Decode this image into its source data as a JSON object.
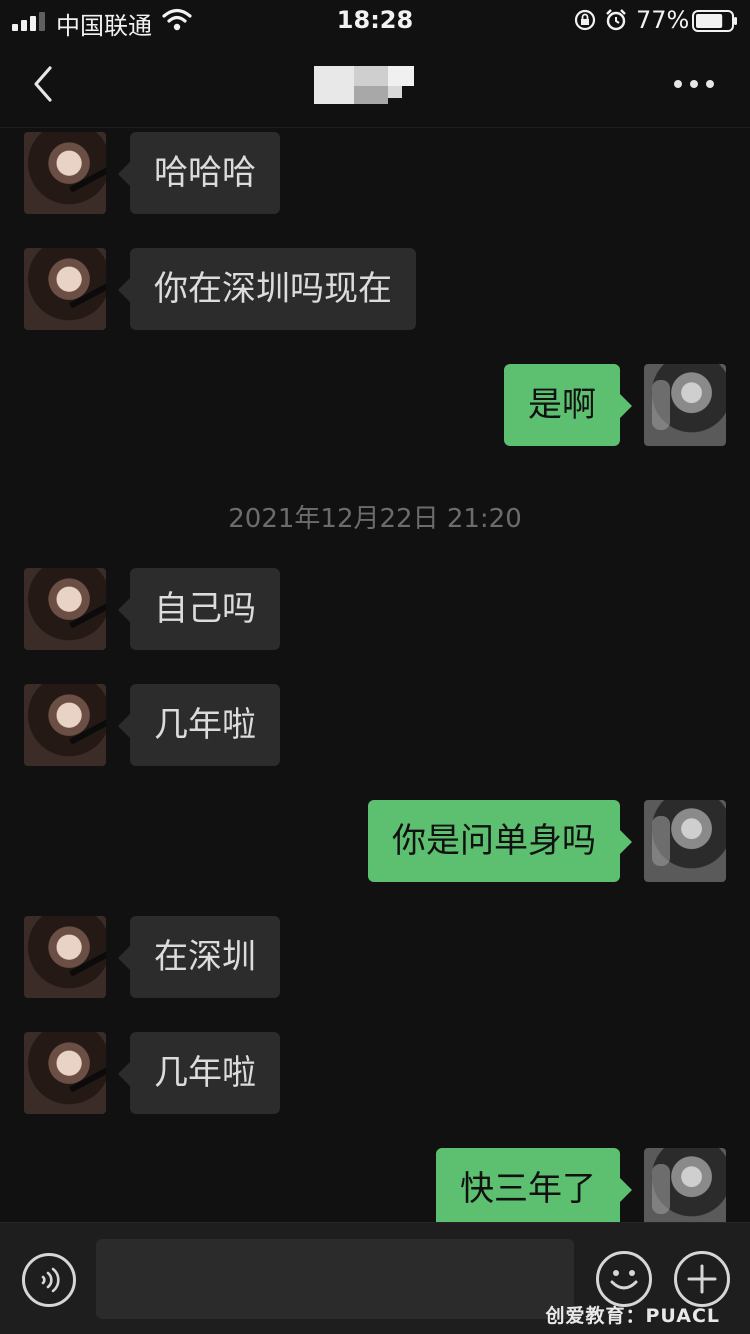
{
  "status_bar": {
    "carrier": "中国联通",
    "time": "18:28",
    "battery_percent": "77%",
    "battery_level": 0.77,
    "icons": [
      "signal-icon",
      "wifi-icon",
      "rotation-lock-icon",
      "alarm-icon",
      "battery-icon"
    ]
  },
  "nav": {
    "back_icon": "chevron-left-icon",
    "contact_name_obscured": true,
    "more_icon": "more-dots-icon"
  },
  "messages": [
    {
      "side": "in",
      "text": "哈哈哈"
    },
    {
      "side": "in",
      "text": "你在深圳吗现在"
    },
    {
      "side": "out",
      "text": "是啊"
    },
    {
      "type": "timestamp",
      "text": "2021年12月22日 21:20"
    },
    {
      "side": "in",
      "text": "自己吗"
    },
    {
      "side": "in",
      "text": "几年啦"
    },
    {
      "side": "out",
      "text": "你是问单身吗"
    },
    {
      "side": "in",
      "text": "在深圳"
    },
    {
      "side": "in",
      "text": "几年啦"
    },
    {
      "side": "out",
      "text": "快三年了"
    }
  ],
  "input_bar": {
    "voice_icon": "voice-icon",
    "input_value": "",
    "emoji_icon": "emoji-icon",
    "plus_icon": "plus-icon"
  },
  "watermark": "创爱教育：PUACL",
  "colors": {
    "background": "#111111",
    "incoming_bubble": "#2c2c2c",
    "outgoing_bubble": "#5dbf70",
    "timestamp_text": "#6c6c6c"
  }
}
